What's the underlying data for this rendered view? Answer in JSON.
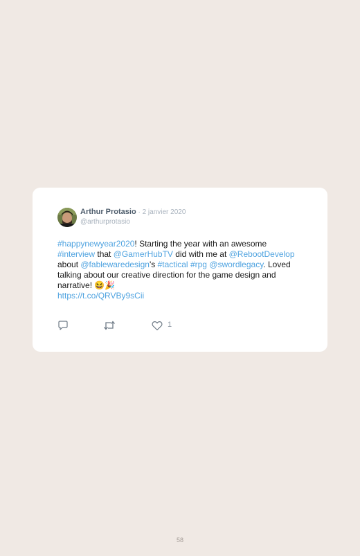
{
  "tweet": {
    "author_name": "Arthur Protasio",
    "separator": " · ",
    "date": "2 janvier 2020",
    "handle": "@arthurprotasio",
    "text": [
      {
        "t": "#happynewyear2020",
        "link": true
      },
      {
        "t": "! Starting the year with an awesome ",
        "link": false
      },
      {
        "t": "#interview",
        "link": true
      },
      {
        "t": " that ",
        "link": false
      },
      {
        "t": "@GamerHubTV",
        "link": true
      },
      {
        "t": " did with me at ",
        "link": false
      },
      {
        "t": "@RebootDevelop",
        "link": true
      },
      {
        "t": " about ",
        "link": false
      },
      {
        "t": "@fablewaredesign",
        "link": true
      },
      {
        "t": "'s ",
        "link": false
      },
      {
        "t": "#tactical",
        "link": true
      },
      {
        "t": " ",
        "link": false
      },
      {
        "t": "#rpg",
        "link": true
      },
      {
        "t": " ",
        "link": false
      },
      {
        "t": "@swordlegacy",
        "link": true
      },
      {
        "t": ". Loved talking about our creative direction for the game design and narrative! 😆🎉",
        "link": false
      },
      {
        "t": "https://t.co/QRVBy9sCii",
        "link": true
      }
    ],
    "like_count": "1",
    "link_color": "#4fa3e0",
    "icons": [
      "reply-icon",
      "retweet-icon",
      "like-icon"
    ]
  },
  "page_number": "58"
}
